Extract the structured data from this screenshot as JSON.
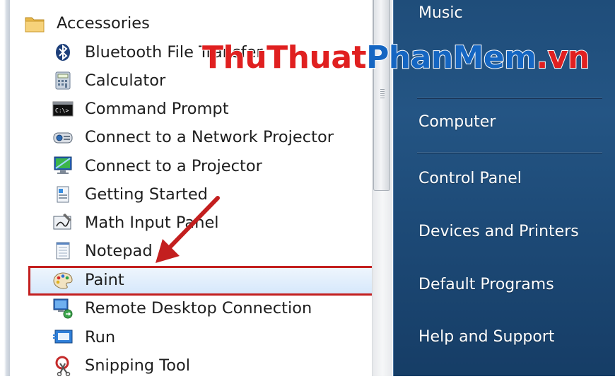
{
  "start_menu": {
    "programs_folder": {
      "label": "Accessories",
      "icon": "folder-icon"
    },
    "items": [
      {
        "label": "Bluetooth File Transfer",
        "icon": "bluetooth-icon"
      },
      {
        "label": "Calculator",
        "icon": "calculator-icon"
      },
      {
        "label": "Command Prompt",
        "icon": "command-prompt-icon"
      },
      {
        "label": "Connect to a Network Projector",
        "icon": "network-projector-icon"
      },
      {
        "label": "Connect to a Projector",
        "icon": "projector-icon"
      },
      {
        "label": "Getting Started",
        "icon": "getting-started-icon"
      },
      {
        "label": "Math Input Panel",
        "icon": "math-input-icon"
      },
      {
        "label": "Notepad",
        "icon": "notepad-icon"
      },
      {
        "label": "Paint",
        "icon": "paint-palette-icon",
        "selected": true
      },
      {
        "label": "Remote Desktop Connection",
        "icon": "remote-desktop-icon"
      },
      {
        "label": "Run",
        "icon": "run-icon"
      },
      {
        "label": "Snipping Tool",
        "icon": "scissors-icon"
      }
    ],
    "right_links": [
      "Music",
      "Computer",
      "Control Panel",
      "Devices and Printers",
      "Default Programs",
      "Help and Support"
    ]
  },
  "watermark": {
    "part1": "ThuThuat",
    "part2": "PhanMem",
    "part3": ".vn"
  },
  "colors": {
    "highlight_border": "#c31f1f",
    "arrow": "#c31f1f",
    "right_pane": "#245584",
    "watermark_red": "#e02020",
    "watermark_blue": "#1566c2"
  }
}
